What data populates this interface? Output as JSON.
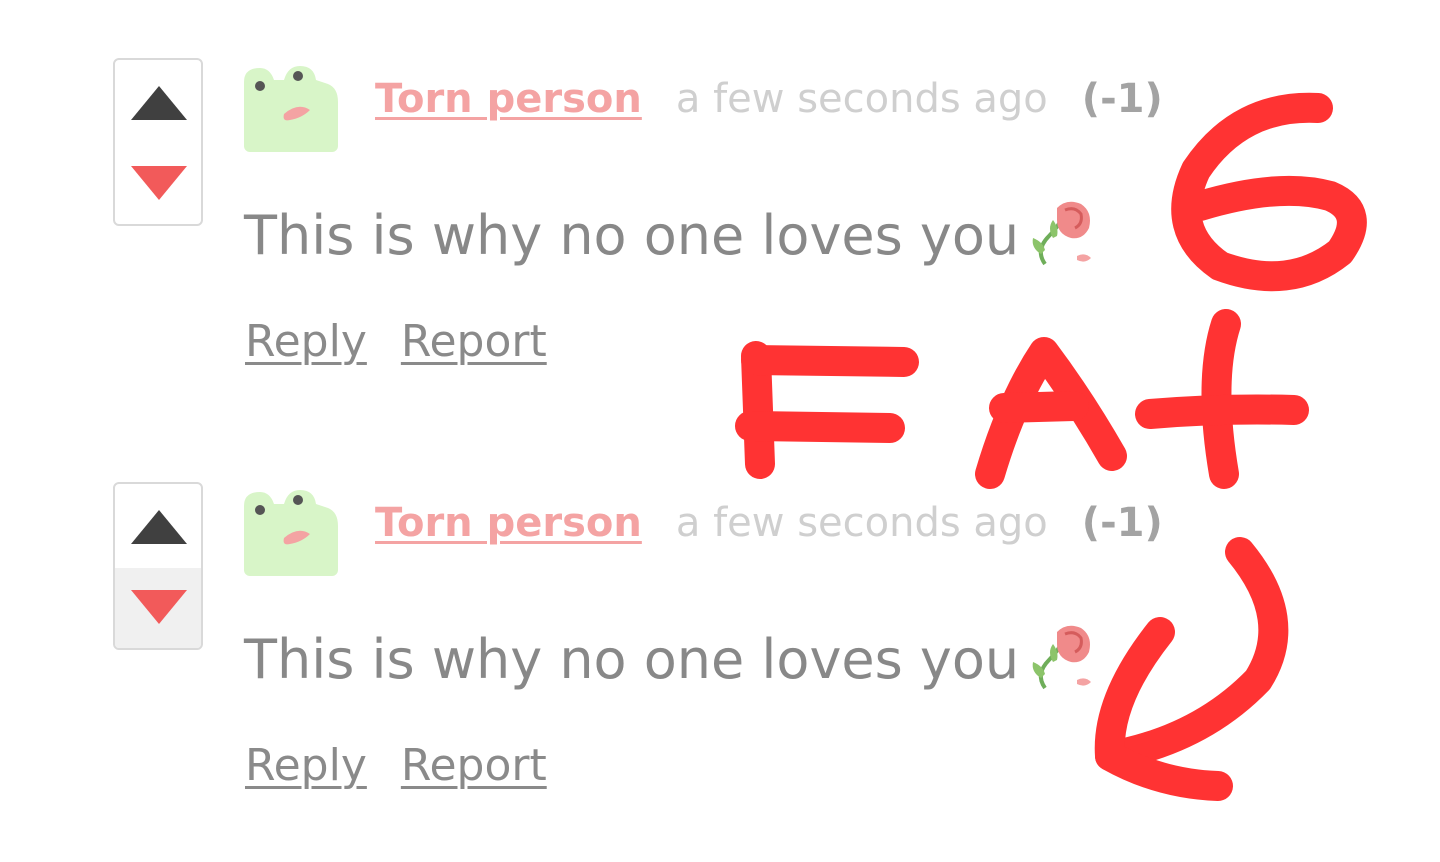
{
  "comments": [
    {
      "author": "Torn person",
      "timestamp": "a few seconds ago",
      "score": "(-1)",
      "body": "This is why no one loves you",
      "body_emoji": "wilted-rose-icon",
      "actions": {
        "reply": "Reply",
        "report": "Report"
      },
      "downvote_active": false
    },
    {
      "author": "Torn person",
      "timestamp": "a few seconds ago",
      "score": "(-1)",
      "body": "This is why no one loves you",
      "body_emoji": "wilted-rose-icon",
      "actions": {
        "reply": "Reply",
        "report": "Report"
      },
      "downvote_active": true
    }
  ],
  "colors": {
    "author": "#f4a3a3",
    "upvote": "#404040",
    "downvote": "#f25a5a",
    "annotation": "#ff3333",
    "avatar_bg": "#d8f5c8"
  },
  "annotation": {
    "description_marks": "hand-drawn red scribbles",
    "letters": [
      "6",
      "F",
      "A",
      "t"
    ],
    "arrow": "down-left arrow pointing at second comment"
  }
}
